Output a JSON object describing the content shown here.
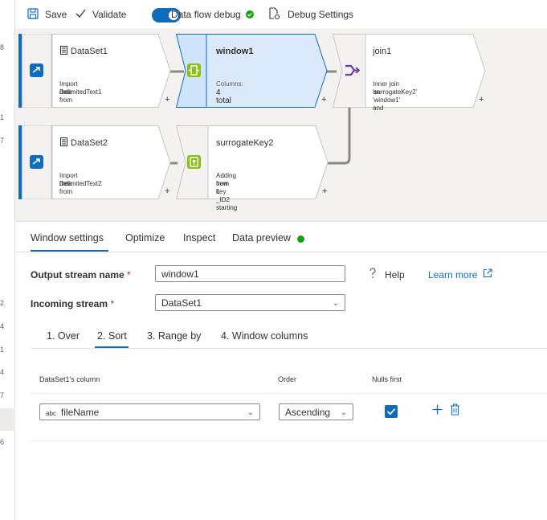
{
  "toolbar": {
    "save": "Save",
    "validate": "Validate",
    "debug": "Data flow debug",
    "debug_settings": "Debug Settings"
  },
  "gutter_numbers": [
    "8",
    "1",
    "7",
    "2",
    "4",
    "1",
    "4",
    "7",
    "6"
  ],
  "nodes": {
    "dataset1": {
      "title": "DataSet1",
      "sub1": "Import data from",
      "sub2": "DelimitedText1"
    },
    "window1": {
      "title": "window1",
      "sub1": "Columns:",
      "sub2": "4 total"
    },
    "join1": {
      "title": "join1",
      "sub1": "Inner join on 'window1' and",
      "sub2": "'surrogateKey2'"
    },
    "dataset2": {
      "title": "DataSet2",
      "sub1": "Import data from",
      "sub2": "DelimitedText2"
    },
    "surrogate": {
      "title": "surrogateKey2",
      "sub1": "Adding new key _ID2 starting",
      "sub2": "from 1"
    },
    "plus": "+"
  },
  "tabs": [
    "Window settings",
    "Optimize",
    "Inspect",
    "Data preview"
  ],
  "form": {
    "output_label": "Output stream name",
    "output_value": "window1",
    "incoming_label": "Incoming stream",
    "incoming_value": "DataSet1",
    "required": "*",
    "help": "Help",
    "learn_more": "Learn more"
  },
  "subtabs": [
    "1. Over",
    "2. Sort",
    "3. Range by",
    "4. Window columns"
  ],
  "sort": {
    "col_column": "DataSet1's column",
    "col_order": "Order",
    "col_nulls": "Nulls first",
    "type_badge": "abc",
    "column_value": "fileName",
    "order_value": "Ascending",
    "nulls_first": true
  },
  "colors": {
    "accent": "#0f6cbd",
    "selected_node": "#dbeafb",
    "status_green": "#13a10e"
  }
}
